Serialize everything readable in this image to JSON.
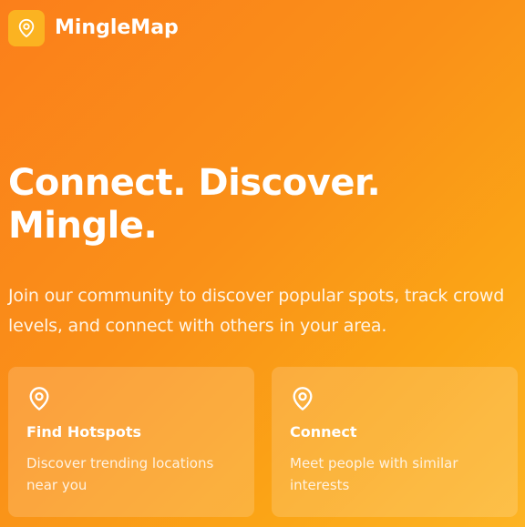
{
  "header": {
    "app_name": "MingleMap",
    "logo_icon": "map-pin-icon"
  },
  "hero": {
    "title_line1": "Connect. Discover.",
    "title_line2": "Mingle.",
    "subtitle": "Join our community to discover popular spots, track crowd levels, and connect with others in your area."
  },
  "features": [
    {
      "icon": "map-pin-icon",
      "title": "Find Hotspots",
      "description": "Discover trending locations near you"
    },
    {
      "icon": "map-pin-icon",
      "title": "Connect",
      "description": "Meet people with similar interests"
    }
  ],
  "colors": {
    "background_start": "#fb7f1b",
    "background_end": "#fdb424",
    "logo_bg": "#fbb321",
    "text": "#ffffff"
  }
}
